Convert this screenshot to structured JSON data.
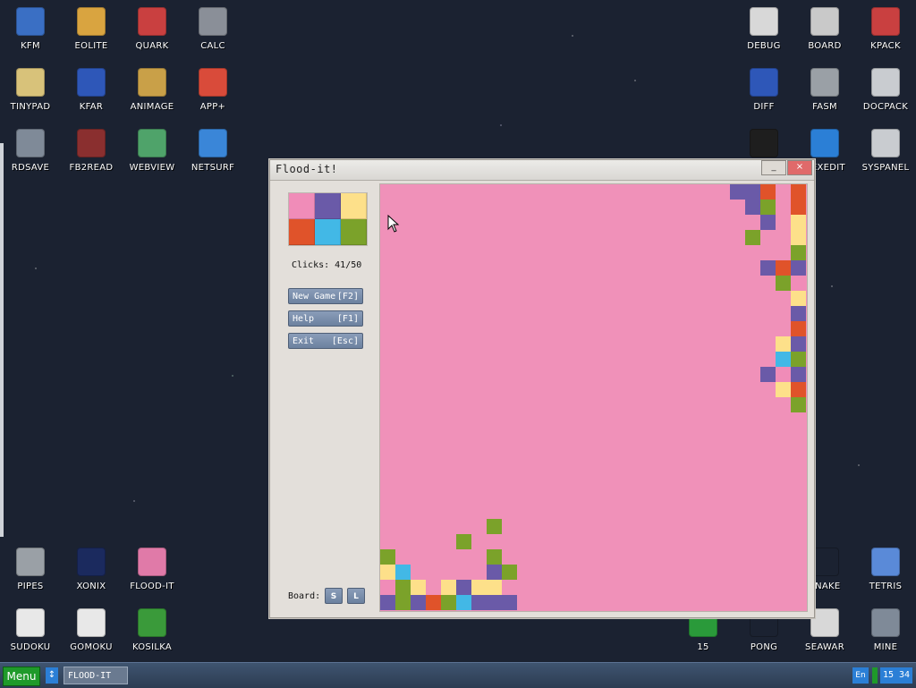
{
  "desktop": {
    "icons_left": [
      {
        "label": "KFM",
        "icon": "floppy-icon",
        "color": "#3a6fc4"
      },
      {
        "label": "EOLITE",
        "icon": "folder-icon",
        "color": "#d9a440"
      },
      {
        "label": "QUARK",
        "icon": "notebook-icon",
        "color": "#c94040"
      },
      {
        "label": "CALC",
        "icon": "calculator-icon",
        "color": "#8a8f98"
      },
      {
        "label": "TINYPAD",
        "icon": "notepad-icon",
        "color": "#d8c27a"
      },
      {
        "label": "KFAR",
        "icon": "panels-icon",
        "color": "#2e57b8"
      },
      {
        "label": "ANIMAGE",
        "icon": "pencil-ruler-icon",
        "color": "#c9a048"
      },
      {
        "label": "APP+",
        "icon": "rubik-cube-icon",
        "color": "#d94b3a"
      },
      {
        "label": "RDSAVE",
        "icon": "ramdisk-save-icon",
        "color": "#7f8a98"
      },
      {
        "label": "FB2READ",
        "icon": "book-icon",
        "color": "#8a2f2f"
      },
      {
        "label": "WEBVIEW",
        "icon": "globe-window-icon",
        "color": "#4fa36a"
      },
      {
        "label": "NETSURF",
        "icon": "globe-icon",
        "color": "#3a86d8"
      },
      {
        "label": "PIPES",
        "icon": "pipes-icon",
        "color": "#9aa0a6"
      },
      {
        "label": "XONIX",
        "icon": "xonix-icon",
        "color": "#1b2a5e"
      },
      {
        "label": "FLOOD-IT",
        "icon": "flood-it-icon",
        "color": "#e07aa8"
      },
      {
        "label": "SUDOKU",
        "icon": "sudoku-icon",
        "color": "#e8e8e8"
      },
      {
        "label": "GOMOKU",
        "icon": "gomoku-icon",
        "color": "#e8e8e8"
      },
      {
        "label": "KOSILKA",
        "icon": "lawnmower-icon",
        "color": "#3a9a3a"
      }
    ],
    "icons_right": [
      {
        "label": "DEBUG",
        "icon": "bug-icon",
        "color": "#d8d8d8"
      },
      {
        "label": "BOARD",
        "icon": "board-window-icon",
        "color": "#c9c9c9"
      },
      {
        "label": "KPACK",
        "icon": "hammer-icon",
        "color": "#c94040"
      },
      {
        "label": "DIFF",
        "icon": "diff-icon",
        "color": "#2e57b8"
      },
      {
        "label": "FASM",
        "icon": "fasm-icon",
        "color": "#9aa0a6"
      },
      {
        "label": "DOCPACK",
        "icon": "drawer-icon",
        "color": "#c9ccd0"
      },
      {
        "label": "",
        "icon": "terminal-icon",
        "color": "#1e1e1e"
      },
      {
        "label": "HEXEDIT",
        "icon": "hex-icon",
        "color": "#2b7fd6"
      },
      {
        "label": "SYSPANEL",
        "icon": "sliders-icon",
        "color": "#c9ccd0"
      },
      {
        "label": "SNAKE",
        "icon": "snake-icon",
        "color": "#1b2231"
      },
      {
        "label": "TETRIS",
        "icon": "tetris-icon",
        "color": "#5a8ad8"
      },
      {
        "label": "15",
        "icon": "fifteen-icon",
        "color": "#2a9a3a"
      },
      {
        "label": "PONG",
        "icon": "pong-icon",
        "color": "#1b2231"
      },
      {
        "label": "SEAWAR",
        "icon": "sea-battle-icon",
        "color": "#d8d8d8"
      },
      {
        "label": "MINE",
        "icon": "mine-icon",
        "color": "#7f8a98"
      }
    ]
  },
  "window": {
    "title": "Flood-it!",
    "minimize": "_",
    "close": "×",
    "palette": [
      "#f08cb8",
      "#6a5aa8",
      "#fde08a",
      "#e0532a",
      "#42b8e6",
      "#7ba22a"
    ],
    "clicks_text": "Clicks: 41/50",
    "buttons": [
      {
        "label": "New Game",
        "key": "[F2]"
      },
      {
        "label": "Help",
        "key": "[F1]"
      },
      {
        "label": "Exit",
        "key": "[Esc]"
      }
    ],
    "board_label": "Board:",
    "size_small": "S",
    "size_large": "L",
    "board_bg": "#f091b9"
  },
  "taskbar": {
    "menu": "Menu",
    "arrow": "↕",
    "task": "FLOOD-IT",
    "lang": "En",
    "time": "15 34"
  }
}
